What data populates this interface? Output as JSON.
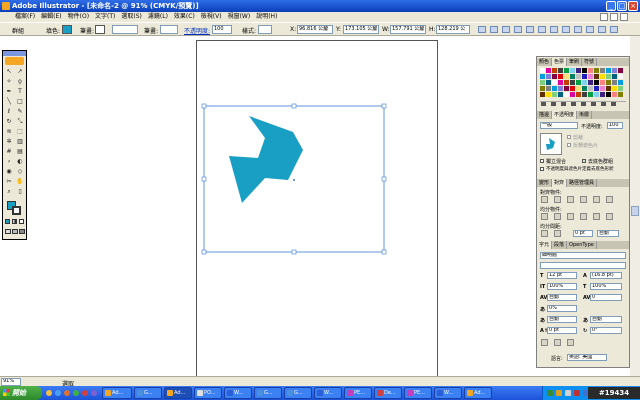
{
  "titlebar": {
    "title": "Adobe Illustrator - [未命名-2 @ 91% (CMYK/預覽)]"
  },
  "menubar": {
    "items": [
      "檔案(F)",
      "編輯(E)",
      "物件(O)",
      "文字(T)",
      "選取(S)",
      "濾鏡(L)",
      "效果(C)",
      "檢視(V)",
      "視窗(W)",
      "說明(H)"
    ]
  },
  "controlbar": {
    "group_label": "群組",
    "fill_label": "填色:",
    "stroke_label": "筆畫:",
    "stroke_weight_label": "筆畫:",
    "opacity_label": "不透明度:",
    "opacity_value": "100",
    "style_label": "樣式:",
    "x_label": "X:",
    "x_value": "96.816 公釐",
    "y_label": "Y:",
    "y_value": "173.105 公釐",
    "w_label": "W:",
    "w_value": "157.791 公釐",
    "h_label": "H:",
    "h_value": "128.219 公"
  },
  "panels": {
    "swatch_tabs": [
      "顏色",
      "色票",
      "筆刷",
      "符號"
    ],
    "transparency_tabs": [
      "描邊",
      "不透明度",
      "漸層"
    ],
    "blend_mode": "一般",
    "opacity_label": "不透明度:",
    "opacity_value": "100",
    "clip_label": "剪裁",
    "invert_mask_label": "反轉遮色片",
    "isolate_blending_label": "獨立混合",
    "knockout_group_label": "去底色群組",
    "opacity_mask_label": "不透明度與遮色片定義去底色形狀",
    "align_tabs": [
      "變形",
      "對齊",
      "路徑管理員"
    ],
    "align_objects_label": "對齊物件:",
    "distribute_objects_label": "均分物件:",
    "distribute_spacing_label": "均分間距:",
    "spacing_value": "0 pt",
    "spacing_mode": "自動",
    "char_tabs": [
      "字元",
      "段落",
      "OpenType"
    ],
    "font_family": "細明體",
    "font_style": "",
    "font_size": "12 pt",
    "leading": "(16.8 pt)",
    "vscale": "100%",
    "hscale": "100%",
    "kerning": "自動",
    "tracking": "0",
    "tsume": "0%",
    "aki_left": "自動",
    "aki_right": "自動",
    "baseline": "0 pt",
    "rotation": "0°",
    "language_label": "語言:",
    "language_value": "英語: 美國"
  },
  "statusbar": {
    "zoom": "91%",
    "status": "選取"
  },
  "taskbar": {
    "start_label": "開始",
    "buttons": [
      "Ad...",
      "G...",
      "Ad...",
      "PO...",
      "W...",
      "G...",
      "G...",
      "W...",
      "PE...",
      "De...",
      "PE...",
      "W...",
      "Ad..."
    ],
    "clock": "",
    "watermark": "#19434"
  },
  "colors": {
    "shape_fill": "#1a9fc4",
    "selection": "#3a7bd5",
    "title_bar": "#0a3fb8",
    "taskbar": "#245edb"
  }
}
